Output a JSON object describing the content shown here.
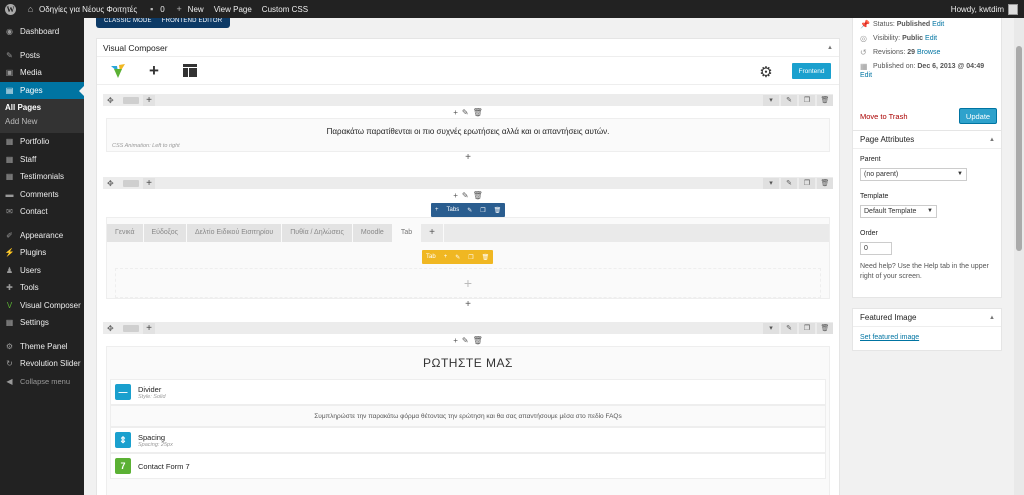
{
  "adminbar": {
    "site_name": "Οδηγίες για Νέους Φοιτητές",
    "comments_count": "0",
    "new_label": "New",
    "view_page": "View Page",
    "custom_css": "Custom CSS",
    "howdy": "Howdy, kwtdim"
  },
  "sidebar": {
    "items": [
      {
        "label": "Dashboard",
        "icon": "dashboard-icon"
      },
      {
        "label": "Posts",
        "icon": "pin-icon"
      },
      {
        "label": "Media",
        "icon": "media-icon"
      },
      {
        "label": "Pages",
        "icon": "pages-icon"
      },
      {
        "label": "Portfolio",
        "icon": "portfolio-icon"
      },
      {
        "label": "Staff",
        "icon": "staff-icon"
      },
      {
        "label": "Testimonials",
        "icon": "testimonials-icon"
      },
      {
        "label": "Comments",
        "icon": "comments-icon"
      },
      {
        "label": "Contact",
        "icon": "contact-icon"
      },
      {
        "label": "Appearance",
        "icon": "appearance-icon"
      },
      {
        "label": "Plugins",
        "icon": "plugins-icon"
      },
      {
        "label": "Users",
        "icon": "users-icon"
      },
      {
        "label": "Tools",
        "icon": "tools-icon"
      },
      {
        "label": "Visual Composer",
        "icon": "visual-composer-icon"
      },
      {
        "label": "Settings",
        "icon": "settings-icon"
      },
      {
        "label": "Theme Panel",
        "icon": "theme-panel-icon"
      },
      {
        "label": "Revolution Slider",
        "icon": "revolution-slider-icon"
      },
      {
        "label": "Collapse menu",
        "icon": "collapse-icon"
      }
    ],
    "submenu": [
      "All Pages",
      "Add New"
    ]
  },
  "editor": {
    "classic_mode": "CLASSIC MODE",
    "frontend_editor": "FRONTEND EDITOR",
    "title": "Visual Composer",
    "frontend_button": "Frontend",
    "row1_text": "Παρακάτω παρατίθενται οι πιο συχνές ερωτήσεις αλλά και οι απαντήσεις αυτών.",
    "row1_anim": "CSS Animation: Left to right",
    "tabs_label": "Tabs",
    "tabs": [
      "Γενικά",
      "Εύδοξος",
      "Δελτίο Ειδικού Εισιτηρίου",
      "Πυθία / Δηλώσεις",
      "Moodle",
      "Tab"
    ],
    "tab_ctrl_label": "Tab",
    "ask_title": "ΡΩΤΗΣΤΕ ΜΑΣ",
    "elements": [
      {
        "name": "Divider",
        "sub": "Style: Solid",
        "color": "#1aa0ce",
        "glyph": "—"
      },
      {
        "name": "Spacing",
        "sub": "Spacing: 25px",
        "color": "#1aa0ce",
        "glyph": "⇕"
      },
      {
        "name": "Contact Form 7",
        "sub": "",
        "color": "#5bb134",
        "glyph": "7"
      }
    ],
    "ask_text": "Συμπληρώστε την παρακάτω φόρμα θέτοντας την ερώτηση και θα σας απαντήσουμε μέσα στο πεδίο FAQs"
  },
  "publish": {
    "status_label": "Status:",
    "status_value": "Published",
    "status_edit": "Edit",
    "visibility_label": "Visibility:",
    "visibility_value": "Public",
    "visibility_edit": "Edit",
    "revisions_label": "Revisions:",
    "revisions_value": "29",
    "revisions_browse": "Browse",
    "published_on_label": "Published on:",
    "published_on_value": "Dec 6, 2013 @ 04:49",
    "published_edit": "Edit",
    "move_to_trash": "Move to Trash",
    "update": "Update"
  },
  "page_attributes": {
    "title": "Page Attributes",
    "parent_label": "Parent",
    "parent_value": "(no parent)",
    "template_label": "Template",
    "template_value": "Default Template",
    "order_label": "Order",
    "order_value": "0",
    "help": "Need help? Use the Help tab in the upper right of your screen."
  },
  "featured_image": {
    "title": "Featured Image",
    "link": "Set featured image"
  },
  "colors": {
    "accent": "#0074a2",
    "vc_blue": "#1aa0ce",
    "tabs_head": "#2a5d8f",
    "tab_ctrl": "#f0b722"
  }
}
